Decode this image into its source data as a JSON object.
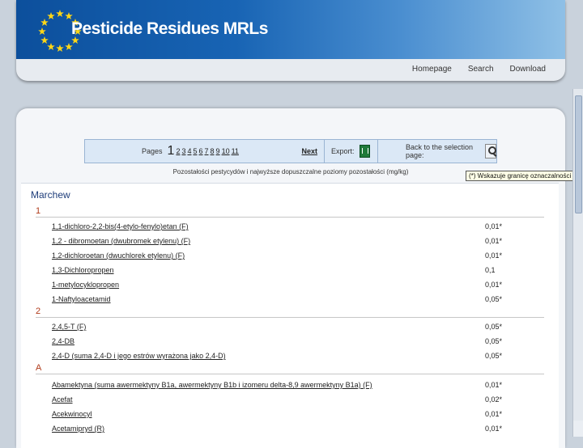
{
  "header": {
    "brand_title": "Pesticide Residues MRLs",
    "nav": [
      "Homepage",
      "Search",
      "Download"
    ]
  },
  "pager": {
    "pages_label": "Pages",
    "current_page": "1",
    "page_links": [
      "2",
      "3",
      "4",
      "5",
      "6",
      "7",
      "8",
      "9",
      "10",
      "11"
    ],
    "next_label": "Next",
    "export_label": "Export:",
    "back_label": "Back to the selection page:"
  },
  "subtitle": "Pozostałości pestycydów i najwyższe dopuszczalne poziomy pozostałości (mg/kg)",
  "product": "Marchew",
  "groups": [
    "1",
    "2",
    "A"
  ],
  "rows": [
    {
      "name": "1,1-dichloro-2,2-bis(4-etylo-fenylo)etan (F)",
      "value": "0,01*"
    },
    {
      "name": "1,2 - dibromoetan (dwubromek etylenu) (F)",
      "value": "0,01*"
    },
    {
      "name": "1,2-dichloroetan (dwuchlorek etylenu) (F)",
      "value": "0,01*"
    },
    {
      "name": "1,3-Dichloropropen",
      "value": "0,1"
    },
    {
      "name": "1-metylocyklopropen",
      "value": "0,01*"
    },
    {
      "name": "1-Naftyloacetamid",
      "value": "0,05*"
    },
    {
      "name": "2,4,5-T (F)",
      "value": "0,05*"
    },
    {
      "name": "2,4-DB",
      "value": "0,05*"
    },
    {
      "name": "2,4-D (suma 2,4-D i jego estrów wyrażona jako 2,4-D)",
      "value": "0,05*"
    },
    {
      "name": "Abamektyna (suma awermektyny B1a, awermektyny B1b i izomeru delta-8,9 awermektyny B1a) (F)",
      "value": "0,01*"
    },
    {
      "name": "Acefat",
      "value": "0,02*"
    },
    {
      "name": "Acekwinocyl",
      "value": "0,01*"
    },
    {
      "name": "Acetamipryd (R)",
      "value": "0,01*"
    }
  ],
  "tooltip": "(*) Wskazuje granicę oznaczalności",
  "colors": {
    "banner": "#1864b4",
    "group_heading": "#b03a1a",
    "product_heading": "#1e3d7a"
  },
  "icons": [
    "eu-stars-logo-icon",
    "excel-icon",
    "magnifier-icon"
  ]
}
